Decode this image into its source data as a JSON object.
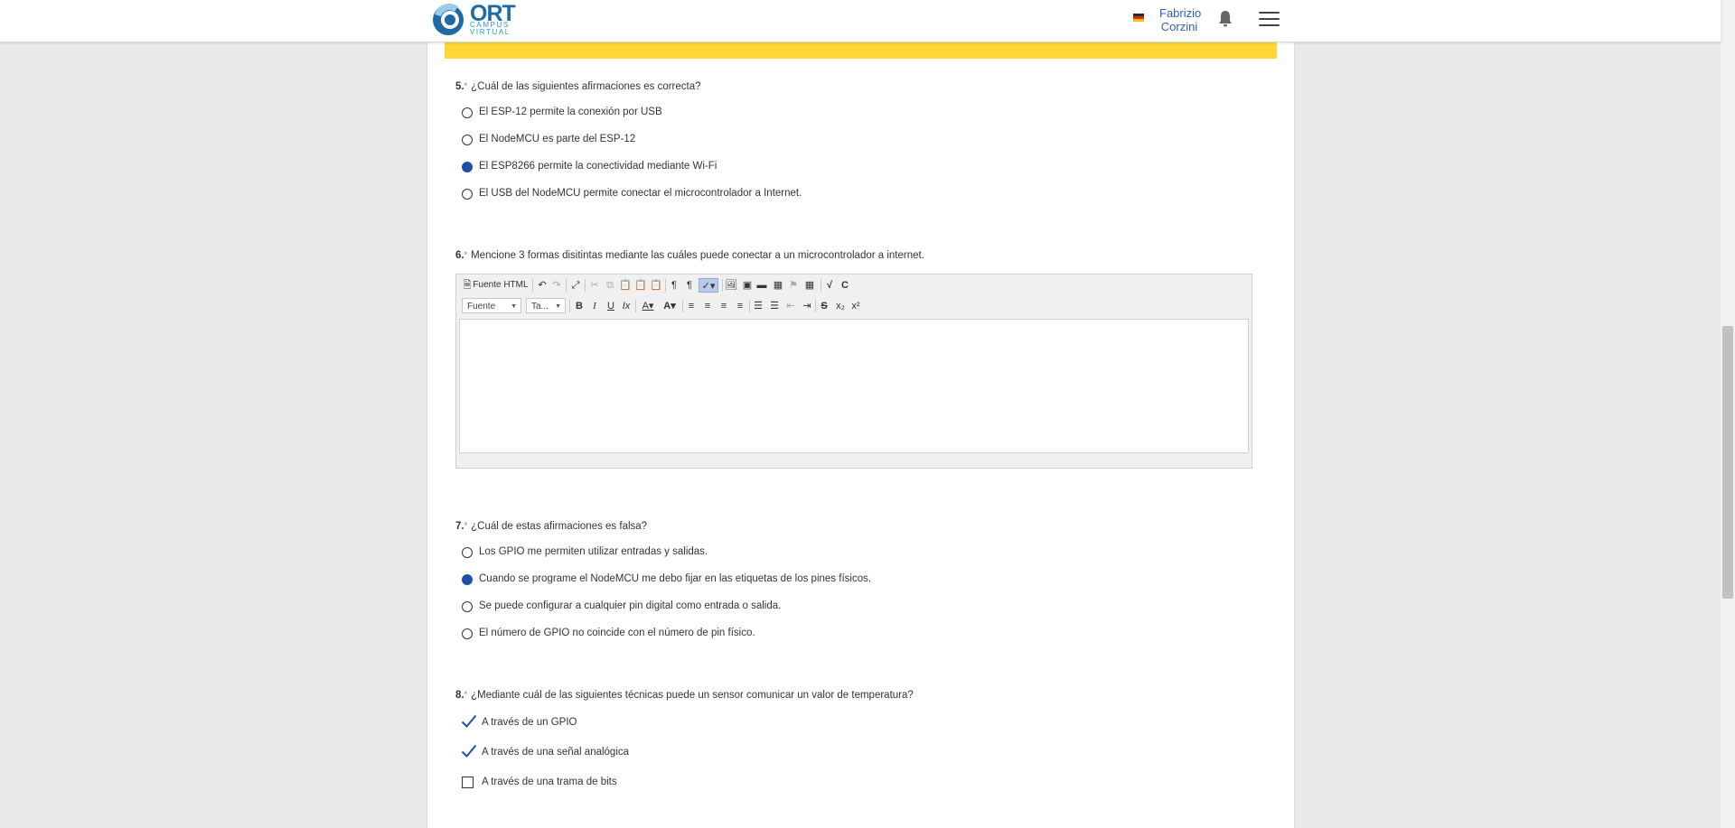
{
  "header": {
    "logo_main": "ORT",
    "logo_sub1": "CAMPUS",
    "logo_sub2": "VIRTUAL",
    "user_first": "Fabrizio",
    "user_last": "Corzini"
  },
  "questions": {
    "q5": {
      "number": "5.",
      "required": "*",
      "text": "¿Cuál de las siguientes afirmaciones es correcta?",
      "options": [
        {
          "label": "El ESP-12 permite la conexión por USB",
          "selected": false
        },
        {
          "label": "El NodeMCU es parte del ESP-12",
          "selected": false
        },
        {
          "label": "El ESP8266 permite la conectividad mediante Wi-Fi",
          "selected": true
        },
        {
          "label": "El USB del NodeMCU permite conectar el microcontrolador a Internet.",
          "selected": false
        }
      ]
    },
    "q6": {
      "number": "6.",
      "required": "*",
      "text": "Mencione 3 formas disitintas mediante las cuáles puede conectar a un microcontrolador a internet.",
      "editor": {
        "source_label": "Fuente HTML",
        "font_combo": "Fuente",
        "size_combo": "Ta...",
        "answer_text": ""
      }
    },
    "q7": {
      "number": "7.",
      "required": "*",
      "text": "¿Cuál de estas afirmaciones es falsa?",
      "options": [
        {
          "label": "Los GPIO me permiten utilizar entradas y salidas.",
          "selected": false
        },
        {
          "label": "Cuando se programe el NodeMCU me debo fijar en las etiquetas de los pines físicos.",
          "selected": true
        },
        {
          "label": "Se puede configurar a cualquier pin digital como entrada o salida.",
          "selected": false
        },
        {
          "label": "El número de GPIO no coincide con el número de pin físico.",
          "selected": false
        }
      ]
    },
    "q8": {
      "number": "8.",
      "required": "*",
      "text": "¿Mediante cuál de las siguientes técnicas puede un sensor comunicar un valor de temperatura?",
      "options": [
        {
          "label": "A través de un GPIO",
          "checked": true
        },
        {
          "label": "A través de una señal analógica",
          "checked": true
        },
        {
          "label": "A través de una trama de bits",
          "checked": false
        }
      ]
    }
  },
  "colors": {
    "accent_blue": "#1f4fa8",
    "banner_yellow": "#fdd835",
    "required_red": "#d9534f"
  }
}
